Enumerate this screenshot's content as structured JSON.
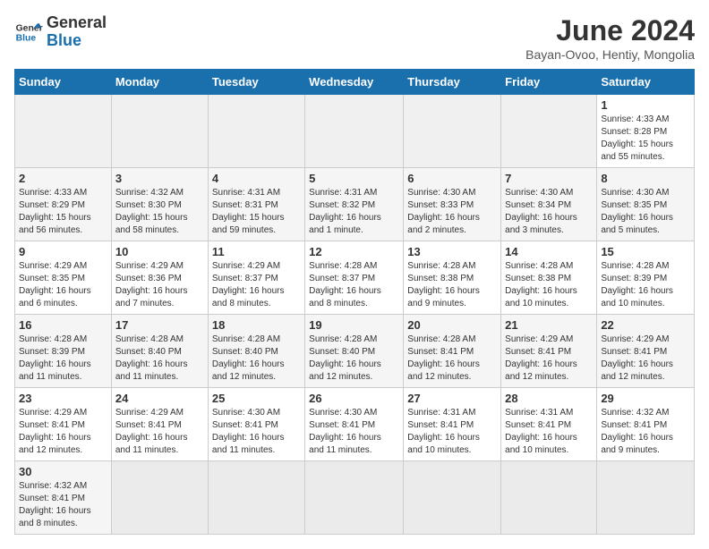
{
  "logo": {
    "line1": "General",
    "line2": "Blue"
  },
  "title": "June 2024",
  "subtitle": "Bayan-Ovoo, Hentiy, Mongolia",
  "weekdays": [
    "Sunday",
    "Monday",
    "Tuesday",
    "Wednesday",
    "Thursday",
    "Friday",
    "Saturday"
  ],
  "weeks": [
    [
      {
        "day": "",
        "info": ""
      },
      {
        "day": "",
        "info": ""
      },
      {
        "day": "",
        "info": ""
      },
      {
        "day": "",
        "info": ""
      },
      {
        "day": "",
        "info": ""
      },
      {
        "day": "",
        "info": ""
      },
      {
        "day": "1",
        "info": "Sunrise: 4:33 AM\nSunset: 8:28 PM\nDaylight: 15 hours\nand 55 minutes."
      }
    ],
    [
      {
        "day": "2",
        "info": "Sunrise: 4:33 AM\nSunset: 8:29 PM\nDaylight: 15 hours\nand 56 minutes."
      },
      {
        "day": "3",
        "info": "Sunrise: 4:32 AM\nSunset: 8:30 PM\nDaylight: 15 hours\nand 58 minutes."
      },
      {
        "day": "4",
        "info": "Sunrise: 4:31 AM\nSunset: 8:31 PM\nDaylight: 15 hours\nand 59 minutes."
      },
      {
        "day": "5",
        "info": "Sunrise: 4:31 AM\nSunset: 8:32 PM\nDaylight: 16 hours\nand 1 minute."
      },
      {
        "day": "6",
        "info": "Sunrise: 4:30 AM\nSunset: 8:33 PM\nDaylight: 16 hours\nand 2 minutes."
      },
      {
        "day": "7",
        "info": "Sunrise: 4:30 AM\nSunset: 8:34 PM\nDaylight: 16 hours\nand 3 minutes."
      },
      {
        "day": "8",
        "info": "Sunrise: 4:30 AM\nSunset: 8:35 PM\nDaylight: 16 hours\nand 5 minutes."
      }
    ],
    [
      {
        "day": "9",
        "info": "Sunrise: 4:29 AM\nSunset: 8:35 PM\nDaylight: 16 hours\nand 6 minutes."
      },
      {
        "day": "10",
        "info": "Sunrise: 4:29 AM\nSunset: 8:36 PM\nDaylight: 16 hours\nand 7 minutes."
      },
      {
        "day": "11",
        "info": "Sunrise: 4:29 AM\nSunset: 8:37 PM\nDaylight: 16 hours\nand 8 minutes."
      },
      {
        "day": "12",
        "info": "Sunrise: 4:28 AM\nSunset: 8:37 PM\nDaylight: 16 hours\nand 8 minutes."
      },
      {
        "day": "13",
        "info": "Sunrise: 4:28 AM\nSunset: 8:38 PM\nDaylight: 16 hours\nand 9 minutes."
      },
      {
        "day": "14",
        "info": "Sunrise: 4:28 AM\nSunset: 8:38 PM\nDaylight: 16 hours\nand 10 minutes."
      },
      {
        "day": "15",
        "info": "Sunrise: 4:28 AM\nSunset: 8:39 PM\nDaylight: 16 hours\nand 10 minutes."
      }
    ],
    [
      {
        "day": "16",
        "info": "Sunrise: 4:28 AM\nSunset: 8:39 PM\nDaylight: 16 hours\nand 11 minutes."
      },
      {
        "day": "17",
        "info": "Sunrise: 4:28 AM\nSunset: 8:40 PM\nDaylight: 16 hours\nand 11 minutes."
      },
      {
        "day": "18",
        "info": "Sunrise: 4:28 AM\nSunset: 8:40 PM\nDaylight: 16 hours\nand 12 minutes."
      },
      {
        "day": "19",
        "info": "Sunrise: 4:28 AM\nSunset: 8:40 PM\nDaylight: 16 hours\nand 12 minutes."
      },
      {
        "day": "20",
        "info": "Sunrise: 4:28 AM\nSunset: 8:41 PM\nDaylight: 16 hours\nand 12 minutes."
      },
      {
        "day": "21",
        "info": "Sunrise: 4:29 AM\nSunset: 8:41 PM\nDaylight: 16 hours\nand 12 minutes."
      },
      {
        "day": "22",
        "info": "Sunrise: 4:29 AM\nSunset: 8:41 PM\nDaylight: 16 hours\nand 12 minutes."
      }
    ],
    [
      {
        "day": "23",
        "info": "Sunrise: 4:29 AM\nSunset: 8:41 PM\nDaylight: 16 hours\nand 12 minutes."
      },
      {
        "day": "24",
        "info": "Sunrise: 4:29 AM\nSunset: 8:41 PM\nDaylight: 16 hours\nand 11 minutes."
      },
      {
        "day": "25",
        "info": "Sunrise: 4:30 AM\nSunset: 8:41 PM\nDaylight: 16 hours\nand 11 minutes."
      },
      {
        "day": "26",
        "info": "Sunrise: 4:30 AM\nSunset: 8:41 PM\nDaylight: 16 hours\nand 11 minutes."
      },
      {
        "day": "27",
        "info": "Sunrise: 4:31 AM\nSunset: 8:41 PM\nDaylight: 16 hours\nand 10 minutes."
      },
      {
        "day": "28",
        "info": "Sunrise: 4:31 AM\nSunset: 8:41 PM\nDaylight: 16 hours\nand 10 minutes."
      },
      {
        "day": "29",
        "info": "Sunrise: 4:32 AM\nSunset: 8:41 PM\nDaylight: 16 hours\nand 9 minutes."
      }
    ],
    [
      {
        "day": "30",
        "info": "Sunrise: 4:32 AM\nSunset: 8:41 PM\nDaylight: 16 hours\nand 8 minutes."
      },
      {
        "day": "",
        "info": ""
      },
      {
        "day": "",
        "info": ""
      },
      {
        "day": "",
        "info": ""
      },
      {
        "day": "",
        "info": ""
      },
      {
        "day": "",
        "info": ""
      },
      {
        "day": "",
        "info": ""
      }
    ]
  ]
}
